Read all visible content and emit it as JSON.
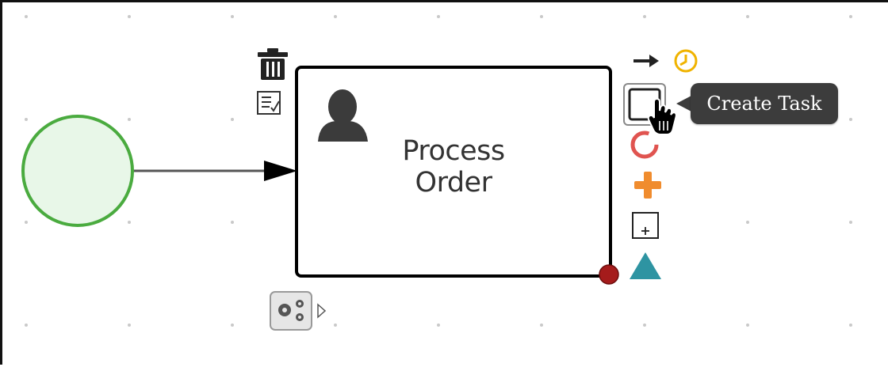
{
  "diagram": {
    "task": {
      "label_line1": "Process",
      "label_line2": "Order",
      "task_type_icon": "user-icon"
    },
    "start_event": {
      "fill": "#e8f7e8",
      "stroke": "#4aab3f"
    },
    "boundary_event_color": "#a51b1b"
  },
  "toolbox": {
    "left_items": [
      {
        "name": "delete",
        "icon": "trash-icon"
      },
      {
        "name": "edit-properties",
        "icon": "properties-icon"
      }
    ],
    "right_items": [
      {
        "name": "create-sequence-flow",
        "icon": "arrow-right-icon"
      },
      {
        "name": "create-intermediate-timer",
        "icon": "clock-icon"
      },
      {
        "name": "create-task",
        "icon": "task-icon"
      },
      {
        "name": "create-end-event",
        "icon": "end-event-icon"
      },
      {
        "name": "create-gateway",
        "icon": "gateway-plus-icon"
      },
      {
        "name": "create-subprocess",
        "icon": "subprocess-icon"
      },
      {
        "name": "create-service-task",
        "icon": "triangle-icon"
      }
    ],
    "morph_button_icon": "gears-icon",
    "tooltip_text": "Create Task"
  },
  "colors": {
    "timer": "#f0b300",
    "end_event": "#e05450",
    "gateway": "#f08c2e",
    "triangle": "#2e94a2"
  }
}
